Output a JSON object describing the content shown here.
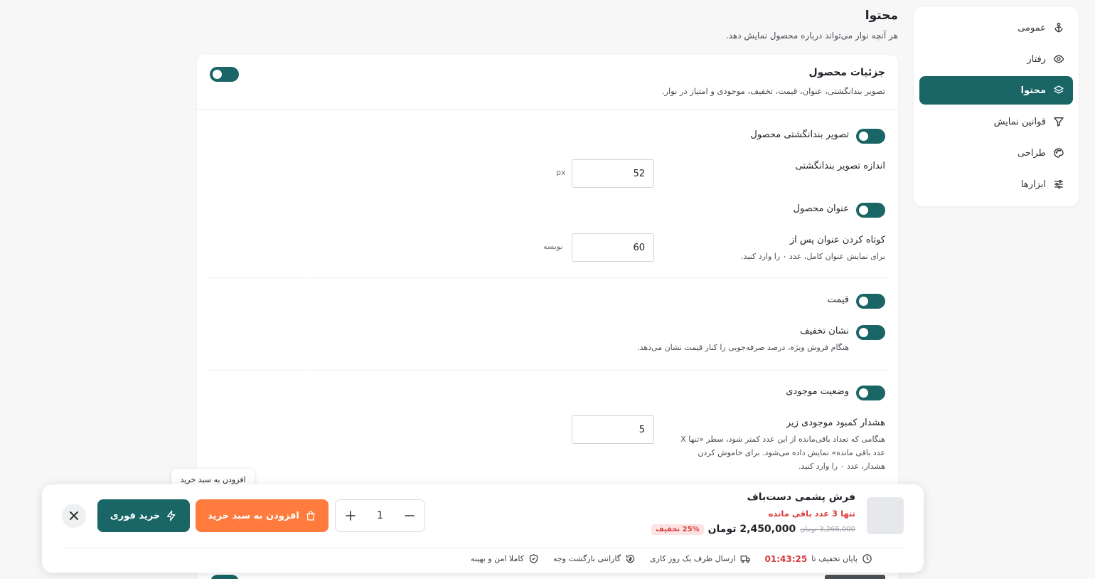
{
  "sidebar": {
    "items": [
      {
        "label": "عمومی",
        "icon": "anchor-icon",
        "active": false
      },
      {
        "label": "رفتار",
        "icon": "eye-icon",
        "active": false
      },
      {
        "label": "محتوا",
        "icon": "layers-icon",
        "active": true
      },
      {
        "label": "قوانین نمایش",
        "icon": "filter-icon",
        "active": false
      },
      {
        "label": "طراحی",
        "icon": "palette-icon",
        "active": false
      },
      {
        "label": "ابزارها",
        "icon": "sliders-icon",
        "active": false
      }
    ]
  },
  "header": {
    "title": "محتوا",
    "description": "هر آنچه نوار می‌تواند درباره محصول نمایش دهد."
  },
  "card": {
    "title": "جزئیات محصول",
    "subtitle": "تصویر بندانگشتی، عنوان، قیمت، تخفیف، موجودی و امتیاز در نوار.",
    "thumbnail": {
      "toggle_label": "تصویر بندانگشتی محصول",
      "size_label": "اندازه تصویر بندانگشتی",
      "size_value": "52",
      "size_unit": "px"
    },
    "product_title": {
      "toggle_label": "عنوان محصول",
      "truncate_label": "کوتاه کردن عنوان پس از",
      "truncate_value": "60",
      "truncate_unit": "نویسه",
      "truncate_hint": "برای نمایش عنوان کامل، عدد ۰ را وارد کنید."
    },
    "price": {
      "toggle_label": "قیمت",
      "discount_label": "نشان تخفیف",
      "discount_hint": "هنگام فروش ویژه، درصد صرفه‌جویی را کنار قیمت نشان می‌دهد."
    },
    "stock": {
      "toggle_label": "وضعیت موجودی",
      "low_stock_label": "هشدار کمبود موجودی زیر",
      "low_stock_value": "5",
      "low_stock_hint": "هنگامی که تعداد باقی‌مانده از این عدد کمتر شود، سطر «تنها X عدد باقی مانده» نمایش داده می‌شود. برای خاموش کردن هشدار، عدد ۰ را وارد کنید."
    }
  },
  "sticky_bar": {
    "product_name": "فرش پشمی دست‌باف",
    "stock_text": "تنها 3 عدد باقی مانده",
    "old_price": "3,266,000 تومان",
    "price": "2,450,000 تومان",
    "discount_badge": "25% تخفیف",
    "quantity": "1",
    "add_to_cart_label": "افزودن به سبد خرید",
    "buy_now_label": "خرید فوری",
    "tooltip": "افزودن به سبد خرید",
    "features": {
      "countdown_label": "پایان تخفیف تا",
      "countdown_value": "01:43:25",
      "shipping": "ارسال ظرف یک روز کاری",
      "guarantee": "گارانتی بازگشت وجه",
      "secure": "کاملا امن و بهینه"
    }
  },
  "colors": {
    "accent": "#1a6565",
    "cart_button": "#ff7a3d",
    "alert": "#d93a3a"
  }
}
